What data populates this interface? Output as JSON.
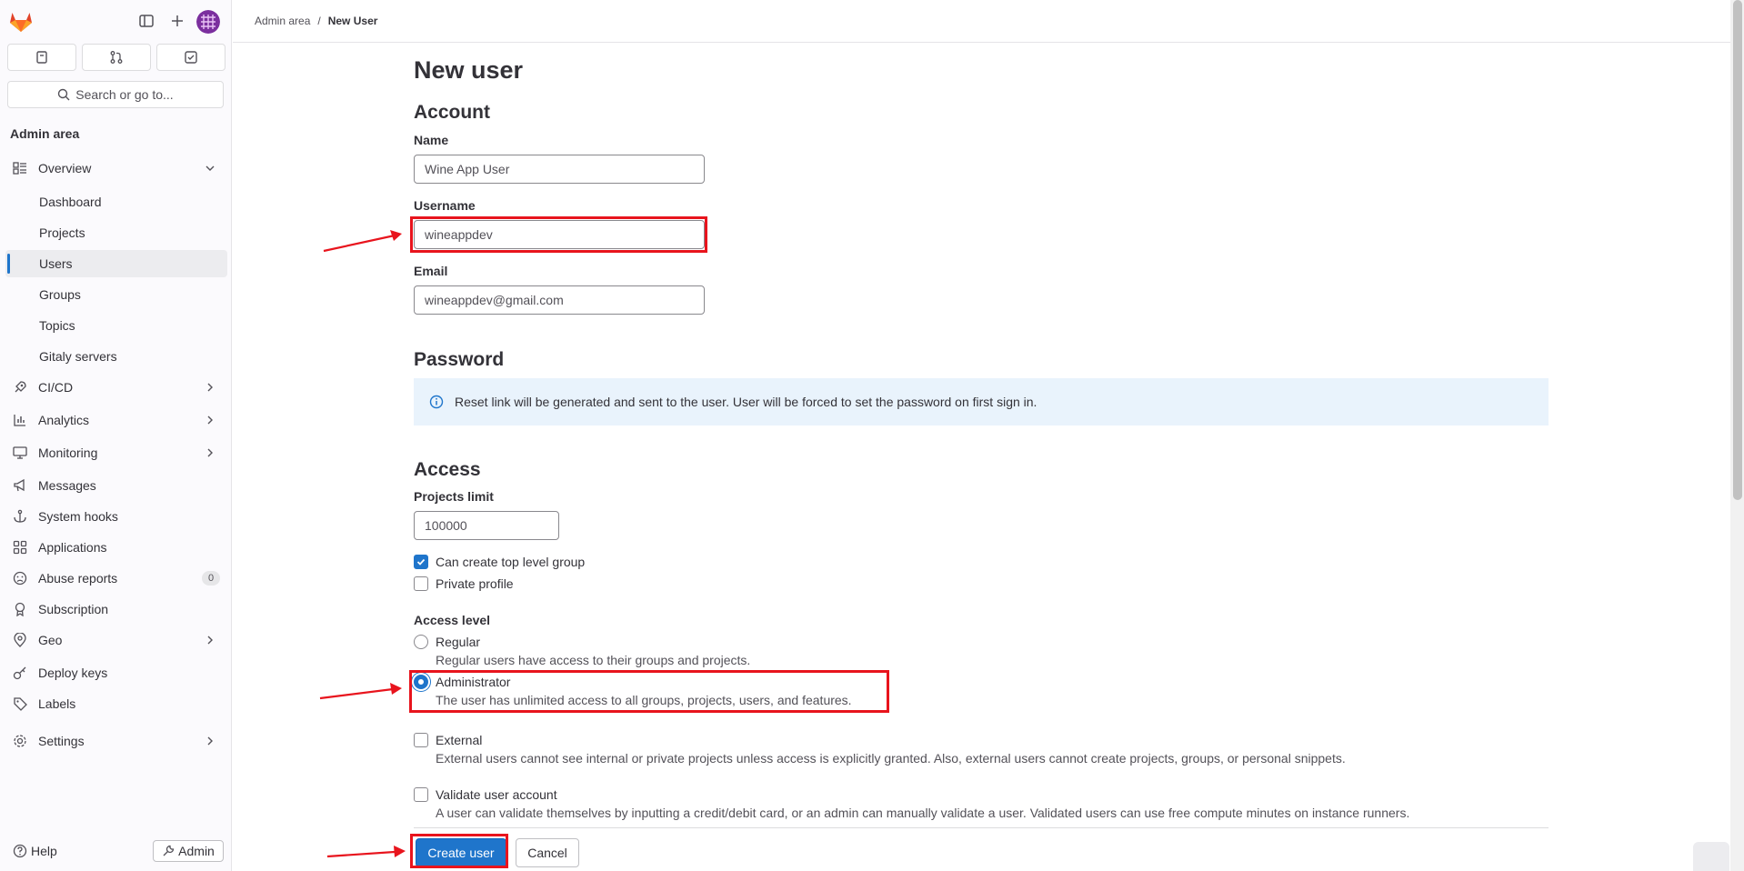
{
  "sidebar": {
    "search_label": "Search or go to...",
    "section_title": "Admin area",
    "items": [
      {
        "label": "Overview"
      },
      {
        "label": "Dashboard"
      },
      {
        "label": "Projects"
      },
      {
        "label": "Users"
      },
      {
        "label": "Groups"
      },
      {
        "label": "Topics"
      },
      {
        "label": "Gitaly servers"
      },
      {
        "label": "CI/CD"
      },
      {
        "label": "Analytics"
      },
      {
        "label": "Monitoring"
      },
      {
        "label": "Messages"
      },
      {
        "label": "System hooks"
      },
      {
        "label": "Applications"
      },
      {
        "label": "Abuse reports",
        "badge": "0"
      },
      {
        "label": "Subscription"
      },
      {
        "label": "Geo"
      },
      {
        "label": "Deploy keys"
      },
      {
        "label": "Labels"
      },
      {
        "label": "Settings"
      }
    ],
    "help_label": "Help",
    "admin_label": "Admin"
  },
  "breadcrumb": {
    "parent": "Admin area",
    "separator": "/",
    "current": "New User"
  },
  "form": {
    "title": "New user",
    "account_heading": "Account",
    "name_label": "Name",
    "name_value": "Wine App User",
    "username_label": "Username",
    "username_value": "wineappdev",
    "email_label": "Email",
    "email_value": "wineappdev@gmail.com",
    "password_heading": "Password",
    "password_info": "Reset link will be generated and sent to the user. User will be forced to set the password on first sign in.",
    "access_heading": "Access",
    "projects_limit_label": "Projects limit",
    "projects_limit_value": "100000",
    "can_create_group_label": "Can create top level group",
    "can_create_group_checked": true,
    "private_profile_label": "Private profile",
    "private_profile_checked": false,
    "access_level_label": "Access level",
    "regular_label": "Regular",
    "regular_help": "Regular users have access to their groups and projects.",
    "admin_label": "Administrator",
    "admin_help": "The user has unlimited access to all groups, projects, users, and features.",
    "selected_access_level": "Administrator",
    "external_label": "External",
    "external_help": "External users cannot see internal or private projects unless access is explicitly granted. Also, external users cannot create projects, groups, or personal snippets.",
    "validate_label": "Validate user account",
    "validate_help": "A user can validate themselves by inputting a credit/debit card, or an admin can manually validate a user. Validated users can use free compute minutes on instance runners.",
    "create_button": "Create user",
    "cancel_button": "Cancel"
  },
  "colors": {
    "primary": "#1f75cb",
    "annotation": "#e8141d",
    "info_bg": "#e9f3fc"
  }
}
